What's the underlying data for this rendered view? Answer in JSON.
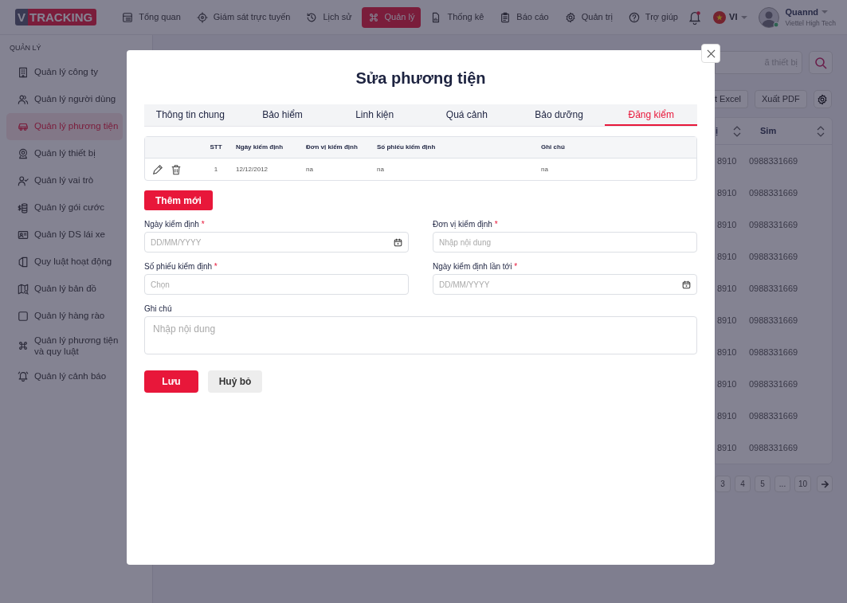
{
  "app": {
    "logo_mark": "V",
    "logo_text": "TRACKING"
  },
  "nav": [
    {
      "label": "Tổng quan",
      "selected": false
    },
    {
      "label": "Giám sát trực tuyến",
      "selected": false
    },
    {
      "label": "Lịch sử",
      "selected": false
    },
    {
      "label": "Quản lý",
      "selected": true
    },
    {
      "label": "Thống kê",
      "selected": false
    },
    {
      "label": "Báo cáo",
      "selected": false
    },
    {
      "label": "Quản trị",
      "selected": false
    },
    {
      "label": "Trợ giúp",
      "selected": false
    }
  ],
  "header": {
    "language": "VI",
    "user_name": "Quannd",
    "user_company": "Viettel High Tech"
  },
  "sidebar": {
    "section": "QUẢN LÝ",
    "items": [
      {
        "label": "Quản lý công ty",
        "selected": false
      },
      {
        "label": "Quản lý người dùng",
        "selected": false
      },
      {
        "label": "Quản lý phương tiện",
        "selected": true
      },
      {
        "label": "Quản lý thiết bị",
        "selected": false
      },
      {
        "label": "Quản lý vai trò",
        "selected": false
      },
      {
        "label": "Quản lý gói cước",
        "selected": false
      },
      {
        "label": "Quản lý DS lái xe",
        "selected": false
      },
      {
        "label": "Quy luật hoạt động",
        "selected": false
      },
      {
        "label": "Quản lý bản đồ",
        "selected": false
      },
      {
        "label": "Quản lý hàng rào",
        "selected": false
      },
      {
        "label": "Quản lý phương tiện và quy luật",
        "selected": false
      },
      {
        "label": "Quản lý cảnh báo",
        "selected": false
      }
    ]
  },
  "background_page": {
    "search_placeholder": "ã thiết bị",
    "export_buttons": [
      "t Excel",
      "Xuất PDF"
    ],
    "columns": [
      "ị",
      "Sim"
    ],
    "rows": [
      [
        "8910",
        "0988331669"
      ],
      [
        "8910",
        "0988331669"
      ],
      [
        "8910",
        "0988331669"
      ],
      [
        "8910",
        "0988331669"
      ],
      [
        "8910",
        "0988331669"
      ],
      [
        "8910",
        "0988331669"
      ],
      [
        "8910",
        "0988331669"
      ],
      [
        "8910",
        "0988331669"
      ],
      [
        "8910",
        "0988331669"
      ],
      [
        "8910",
        "0988331669"
      ]
    ],
    "pagination": [
      "3",
      "4",
      "5",
      "...",
      "10"
    ]
  },
  "modal": {
    "title": "Sửa phương tiện",
    "tabs": [
      {
        "label": "Thông tin chung",
        "selected": false
      },
      {
        "label": "Bảo hiểm",
        "selected": false
      },
      {
        "label": "Linh kiện",
        "selected": false
      },
      {
        "label": "Quá cảnh",
        "selected": false
      },
      {
        "label": "Bảo dưỡng",
        "selected": false
      },
      {
        "label": "Đăng kiểm",
        "selected": true
      }
    ],
    "table": {
      "columns": [
        "STT",
        "Ngày kiểm định",
        "Đơn vị kiểm định",
        "Số phiếu kiểm định",
        "Ghi chú"
      ],
      "rows": [
        {
          "cells": [
            "1",
            "12/12/2012",
            "na",
            "na",
            "na"
          ]
        }
      ]
    },
    "add_button": "Thêm mới",
    "fields": [
      {
        "label": "Ngày kiểm định",
        "required_mark": "*",
        "placeholder": "DD/MM/YYYY",
        "kind": "date"
      },
      {
        "label": "Đơn vị kiểm định",
        "required_mark": "*",
        "placeholder": "Nhập nội dung",
        "kind": "text"
      },
      {
        "label": "Số phiếu kiểm định",
        "required_mark": "*",
        "placeholder": "Chọn",
        "kind": "text"
      },
      {
        "label": "Ngày kiểm định lần tới",
        "required_mark": "*",
        "placeholder": "DD/MM/YYYY",
        "kind": "date"
      }
    ],
    "note": {
      "label": "Ghi chú",
      "placeholder": "Nhập nội dung"
    },
    "save_button": "Lưu",
    "cancel_button": "Huỷ bỏ"
  }
}
